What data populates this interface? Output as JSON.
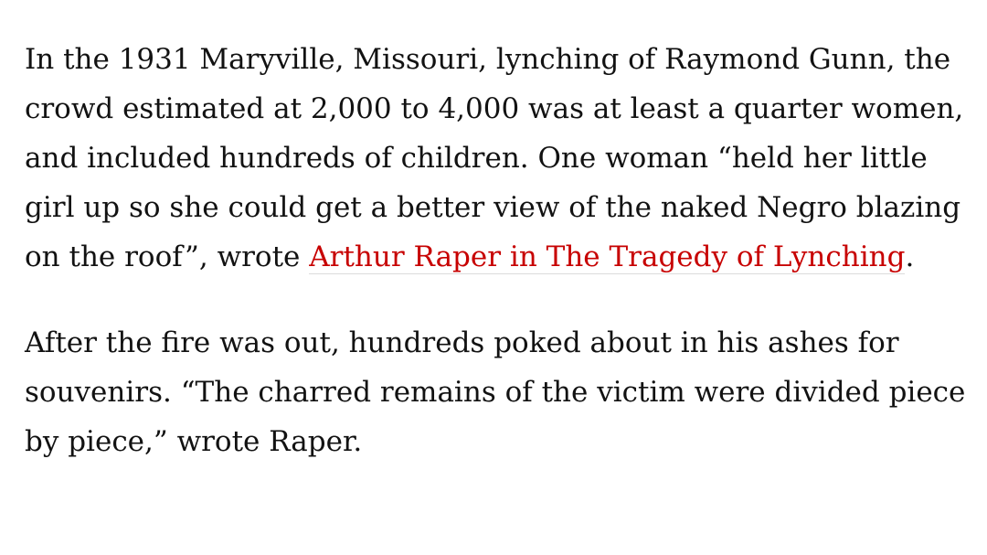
{
  "article": {
    "paragraph_1": {
      "text_before_link": "In the 1931 Maryville, Missouri, lynching of Raymond Gunn, the crowd estimated at 2,000 to 4,000 was at least a quarter women, and included hundreds of children. One woman “held her little girl up so she could get a better view of the naked Negro blazing on the roof”, wrote ",
      "link_text": "Arthur Raper in The Tragedy of Lynching",
      "text_after_link": "."
    },
    "paragraph_2": {
      "text": "After the fire was out, hundreds poked about in his ashes for souvenirs. “The charred remains of the victim were divided piece by piece,” wrote Raper."
    },
    "colors": {
      "text": "#121212",
      "link": "#c70000",
      "background": "#ffffff"
    }
  }
}
